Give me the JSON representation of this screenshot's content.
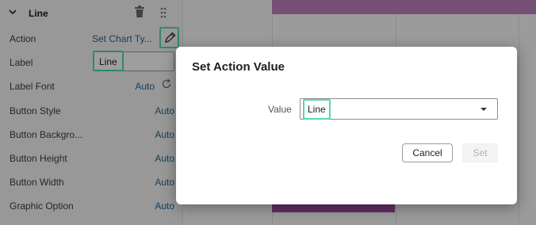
{
  "panel": {
    "title": "Line",
    "rows": [
      {
        "label": "Action",
        "value": "Set Chart Ty..."
      },
      {
        "label": "Label",
        "value": "Line"
      },
      {
        "label": "Label Font",
        "value": "Auto"
      },
      {
        "label": "Button Style",
        "value": "Auto"
      },
      {
        "label": "Button Backgro...",
        "value": "Auto"
      },
      {
        "label": "Button Height",
        "value": "Auto"
      },
      {
        "label": "Button Width",
        "value": "Auto"
      },
      {
        "label": "Graphic Option",
        "value": "Auto"
      }
    ],
    "icons": {
      "collapse": "chevron-down-icon",
      "delete": "trash-icon",
      "drag": "drag-handle-icon",
      "edit": "pencil-icon",
      "reset": "refresh-icon"
    }
  },
  "dialog": {
    "title": "Set Action Value",
    "value_label": "Value",
    "value_selected": "Line",
    "cancel_label": "Cancel",
    "set_label": "Set"
  },
  "colors": {
    "highlight": "#53d9b7",
    "link": "#226795",
    "chart_bar_light": "#c080bf",
    "chart_bar_dark": "#a2499f"
  }
}
